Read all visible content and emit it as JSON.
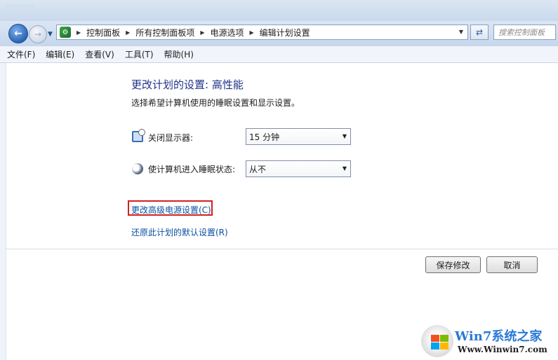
{
  "addressbar": {
    "crumbs": [
      "控制面板",
      "所有控制面板项",
      "电源选项",
      "编辑计划设置"
    ],
    "search_placeholder": "搜索控制面板"
  },
  "menubar": [
    "文件(F)",
    "编辑(E)",
    "查看(V)",
    "工具(T)",
    "帮助(H)"
  ],
  "main": {
    "title": "更改计划的设置: 高性能",
    "subtitle": "选择希望计算机使用的睡眠设置和显示设置。",
    "display_label": "关闭显示器:",
    "display_value": "15 分钟",
    "sleep_label": "使计算机进入睡眠状态:",
    "sleep_value": "从不",
    "advanced_link": "更改高级电源设置(C)",
    "restore_link": "还原此计划的默认设置(R)",
    "save_button": "保存修改",
    "cancel_button": "取消"
  },
  "watermark": {
    "title": "Win7系统之家",
    "url": "Www.Winwin7.com"
  },
  "colors": {
    "title_blue": "#1e3287",
    "link_blue": "#0a4fa0",
    "highlight_red": "#d42020"
  },
  "icons": [
    "back-arrow-icon",
    "forward-arrow-icon",
    "control-panel-icon",
    "refresh-icon",
    "monitor-icon",
    "moon-sleep-icon",
    "windows-logo-icon"
  ]
}
